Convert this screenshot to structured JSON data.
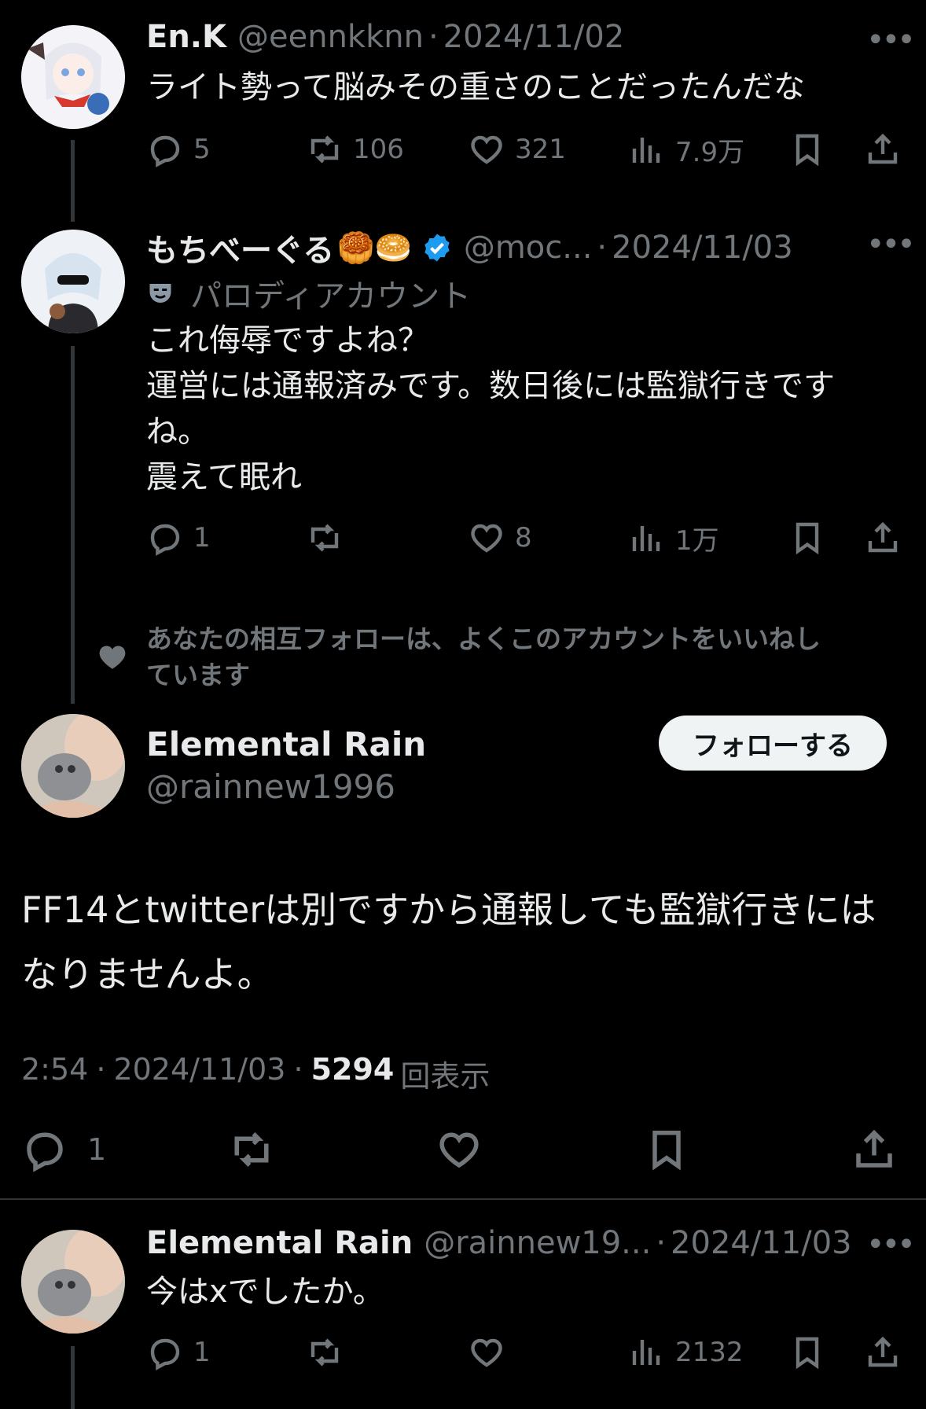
{
  "tweet1": {
    "name": "En.K",
    "handle": "@eennkknn",
    "sep": "·",
    "date": "2024/11/02",
    "text": "ライト勢って脳みその重さのことだったんだな",
    "replies": "5",
    "reposts": "106",
    "likes": "321",
    "views": "7.9万"
  },
  "tweet2": {
    "name": "もちべーぐる",
    "emoji": "🥮🥯",
    "handle": "@moc...",
    "sep": "·",
    "date": "2024/11/03",
    "parody_label": "パロディアカウント",
    "text_lines": [
      "これ侮辱ですよね？",
      "運営には通報済みです。数日後には監獄行きです",
      "ね。",
      "震えて眠れ"
    ],
    "replies": "1",
    "likes": "8",
    "views": "1万"
  },
  "social_context": {
    "text_line1": "あなたの相互フォローは、よくこのアカウントをいいねし",
    "text_line2": "ています"
  },
  "main_tweet": {
    "name": "Elemental Rain",
    "handle": "@rainnew1996",
    "follow_label": "フォローする",
    "text_line1": "FF14とtwitterは別ですから通報しても監獄行きには",
    "text_line2": "なりませんよ。",
    "time": "2:54",
    "date": "2024/11/03",
    "views_count": "5294",
    "views_label": "回表示",
    "replies": "1"
  },
  "reply": {
    "name": "Elemental Rain",
    "handle": "@rainnew19...",
    "sep": "·",
    "date": "2024/11/03",
    "text": "今はxでしたか。",
    "replies": "1",
    "views": "2132"
  },
  "colors": {
    "background": "#000000",
    "text": "#e7e9ea",
    "muted": "#71767b",
    "verified": "#1d9bf0",
    "divider": "#2f3336"
  },
  "icons": [
    "reply-icon",
    "repost-icon",
    "like-icon",
    "views-icon",
    "bookmark-icon",
    "share-icon",
    "more-icon",
    "verified-icon",
    "parody-mask-icon"
  ]
}
